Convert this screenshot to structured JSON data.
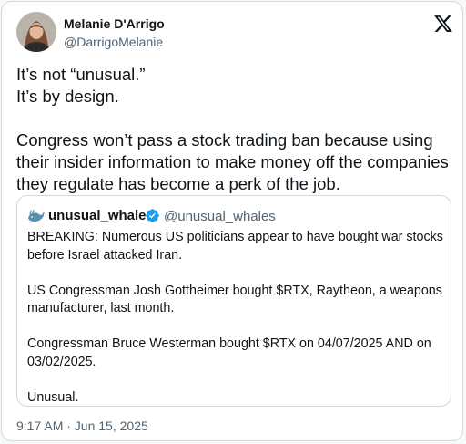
{
  "author": {
    "name": "Melanie D'Arrigo",
    "handle": "@DarrigoMelanie"
  },
  "platform_icon": "x-logo-icon",
  "tweet": {
    "lines": [
      "It’s not “unusual.”",
      "It’s by design.",
      "Congress won’t pass a stock trading ban because using their insider information to make money off the companies they regulate has become a perk of the job."
    ]
  },
  "quoted_tweet": {
    "author_name": "unusual_whales",
    "author_handle": "@unusual_whales",
    "verified": true,
    "paragraphs": [
      "BREAKING: Numerous US politicians appear to have bought war stocks before Israel attacked Iran.",
      "US Congressman Josh Gottheimer bought  $RTX, Raytheon, a weapons manufacturer, last month.",
      "Congressman Bruce Westerman bought $RTX on 04/07/2025 AND on 03/02/2025.",
      "Unusual."
    ]
  },
  "timestamp": "9:17 AM · Jun 15, 2025",
  "colors": {
    "text": "#0f1419",
    "secondary": "#536471",
    "border": "#cfd9de",
    "verified_blue": "#1d9bf0"
  }
}
